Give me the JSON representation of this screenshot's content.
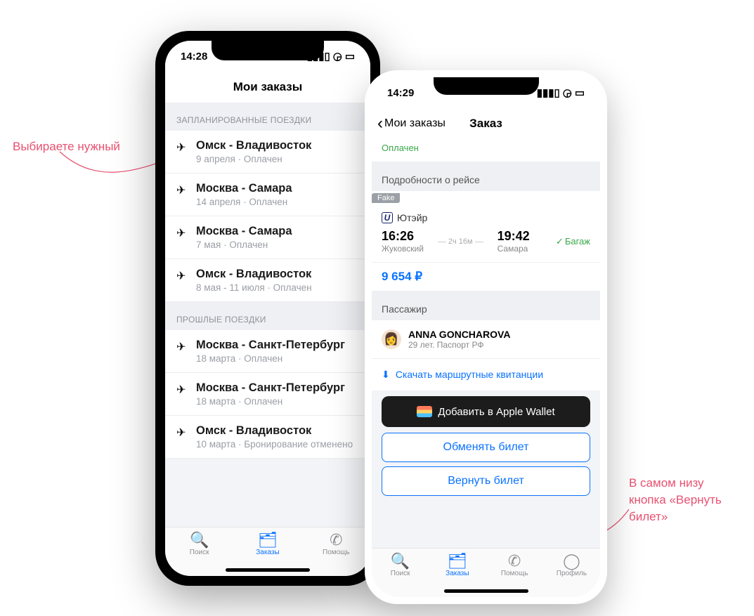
{
  "annotations": {
    "left": "Выбираете нужный",
    "right": "В самом низу кнопка «Вернуть билет»"
  },
  "phone1": {
    "time": "14:28",
    "title": "Мои заказы",
    "section_planned": "ЗАПЛАНИРОВАННЫЕ ПОЕЗДКИ",
    "section_past": "ПРОШЛЫЕ ПОЕЗДКИ",
    "trips_planned": [
      {
        "route": "Омск - Владивосток",
        "sub": "9 апреля · Оплачен"
      },
      {
        "route": "Москва - Самара",
        "sub": "14 апреля · Оплачен"
      },
      {
        "route": "Москва - Самара",
        "sub": "7 мая · Оплачен"
      },
      {
        "route": "Омск - Владивосток",
        "sub": "8 мая - 11 июля · Оплачен"
      }
    ],
    "trips_past": [
      {
        "route": "Москва - Санкт-Петербург",
        "sub": "18 марта · Оплачен"
      },
      {
        "route": "Москва - Санкт-Петербург",
        "sub": "18 марта · Оплачен"
      },
      {
        "route": "Омск - Владивосток",
        "sub": "10 марта · Бронирование отменено"
      }
    ],
    "tabs": {
      "search": "Поиск",
      "orders": "Заказы",
      "help": "Помощь"
    }
  },
  "phone2": {
    "time": "14:29",
    "back_label": "Мои заказы",
    "title": "Заказ",
    "paid_status": "Оплачен",
    "details_header": "Подробности о рейсе",
    "fake_tag": "Fake",
    "carrier": "Ютэйр",
    "dep_time": "16:26",
    "dep_city": "Жуковский",
    "duration": "2ч 16м",
    "arr_time": "19:42",
    "arr_city": "Самара",
    "baggage": "Багаж",
    "price": "9 654 ₽",
    "pax_header": "Пассажир",
    "pax_name": "ANNA GONCHAROVA",
    "pax_detail": "29 лет. Паспорт РФ",
    "download": "Скачать маршрутные квитанции",
    "wallet": "Добавить в Apple Wallet",
    "exchange": "Обменять билет",
    "refund": "Вернуть билет",
    "tabs": {
      "search": "Поиск",
      "orders": "Заказы",
      "help": "Помощь",
      "profile": "Профиль"
    }
  }
}
